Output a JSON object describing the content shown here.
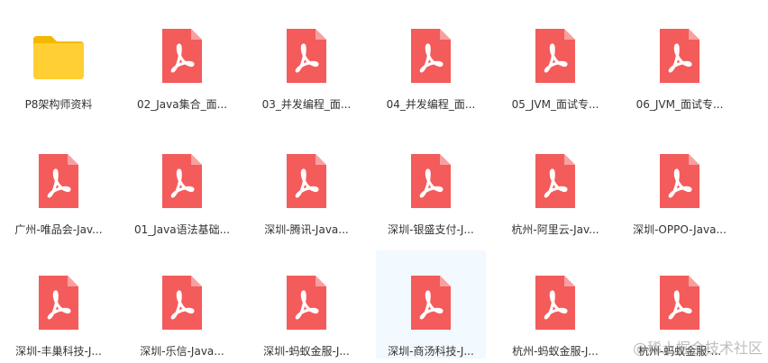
{
  "colors": {
    "pdf_red": "#f45b5b",
    "pdf_fold": "#f8a0a0",
    "folder_yellow": "#ffcf33",
    "folder_tab": "#f5b800",
    "hover_bg": "#f2f9ff",
    "label_text": "#333333"
  },
  "files": [
    {
      "label": "P8架构师资料",
      "icon": "folder-icon"
    },
    {
      "label": "02_Java集合_面...",
      "icon": "pdf-icon"
    },
    {
      "label": "03_并发编程_面...",
      "icon": "pdf-icon"
    },
    {
      "label": "04_并发编程_面...",
      "icon": "pdf-icon"
    },
    {
      "label": "05_JVM_面试专...",
      "icon": "pdf-icon"
    },
    {
      "label": "06_JVM_面试专...",
      "icon": "pdf-icon"
    },
    {
      "label": "广州-唯品会-Jav...",
      "icon": "pdf-icon"
    },
    {
      "label": "01_Java语法基础...",
      "icon": "pdf-icon"
    },
    {
      "label": "深圳-腾讯-Java...",
      "icon": "pdf-icon"
    },
    {
      "label": "深圳-银盛支付-J...",
      "icon": "pdf-icon"
    },
    {
      "label": "杭州-阿里云-Jav...",
      "icon": "pdf-icon"
    },
    {
      "label": "深圳-OPPO-Java...",
      "icon": "pdf-icon"
    },
    {
      "label": "深圳-丰巢科技-J...",
      "icon": "pdf-icon"
    },
    {
      "label": "深圳-乐信-Java...",
      "icon": "pdf-icon"
    },
    {
      "label": "深圳-蚂蚁金服-J...",
      "icon": "pdf-icon"
    },
    {
      "label": "深圳-商汤科技-J...",
      "icon": "pdf-icon",
      "hovered": true
    },
    {
      "label": "杭州-蚂蚁金服-J...",
      "icon": "pdf-icon"
    },
    {
      "label": "杭州-蚂蚁金服-...",
      "icon": "pdf-icon"
    }
  ],
  "watermark": "@稀土掘金技术社区"
}
